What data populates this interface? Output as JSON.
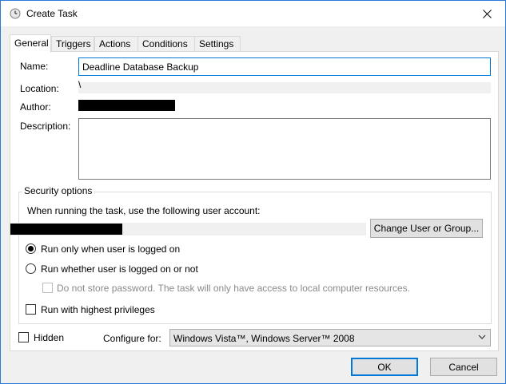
{
  "window": {
    "title": "Create Task",
    "accent": "#0078d7"
  },
  "tabs": [
    "General",
    "Triggers",
    "Actions",
    "Conditions",
    "Settings"
  ],
  "general": {
    "name_label": "Name:",
    "name_value": "Deadline Database Backup",
    "location_label": "Location:",
    "location_value": "\\",
    "author_label": "Author:",
    "description_label": "Description:",
    "description_value": ""
  },
  "security": {
    "legend": "Security options",
    "account_prompt": "When running the task, use the following user account:",
    "change_user_button": "Change User or Group...",
    "radio_logged_on": "Run only when user is logged on",
    "radio_whether": "Run whether user is logged on or not",
    "radio_selected": "logged_on",
    "no_store_password": "Do not store password.  The task will only have access to local computer resources.",
    "highest_privileges": "Run with highest privileges"
  },
  "footer": {
    "hidden_label": "Hidden",
    "configure_label": "Configure for:",
    "configure_value": "Windows Vista™, Windows Server™ 2008",
    "ok_button": "OK",
    "cancel_button": "Cancel"
  }
}
